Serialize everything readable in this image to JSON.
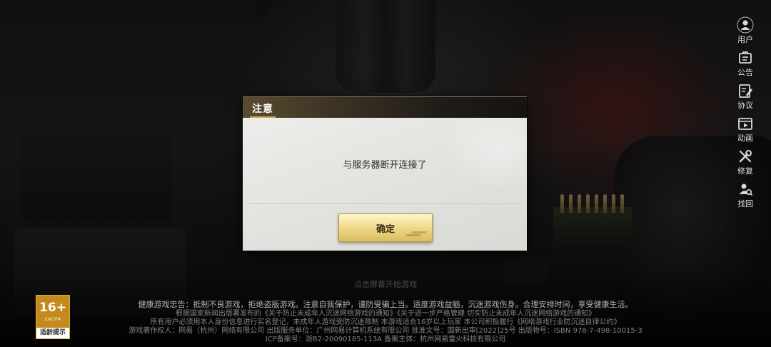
{
  "side_menu": {
    "items": [
      {
        "label": "用户",
        "icon": "user-icon"
      },
      {
        "label": "公告",
        "icon": "notice-icon"
      },
      {
        "label": "协议",
        "icon": "agreement-icon"
      },
      {
        "label": "动画",
        "icon": "animation-icon"
      },
      {
        "label": "修复",
        "icon": "repair-icon"
      },
      {
        "label": "找回",
        "icon": "recover-icon"
      }
    ]
  },
  "dialog": {
    "title": "注意",
    "message": "与服务器断开连接了",
    "confirm_label": "确定"
  },
  "start_hint": "点击屏幕开始游戏",
  "footer": {
    "health_notice": "健康游戏忠告：抵制不良游戏，拒绝盗版游戏。注意自我保护，谨防受骗上当。适度游戏益脑，沉迷游戏伤身。合理安排时间，享受健康生活。",
    "line2": "根据国家新闻出版署发布的《关于防止未成年人沉迷网络游戏的通知》《关于进一步严格管理 切实防止未成年人沉迷网络游戏的通知》",
    "line3": "所有用户必须用本人身份信息进行实名登记，未成年人游戏受防沉迷限制  本游戏适合16岁以上玩家  本公司积极履行《网络游戏行业防沉迷自律公约》",
    "line4": "游戏著作权人：网易（杭州）网络有限公司 出版服务单位：广州网易计算机系统有限公司 批准文号：国新出审[2022]25号 出版物号：ISBN 978-7-498-10015-3",
    "line5": "ICP备案号：浙B2-20090185-113A 备案主体：杭州网易雷火科技有限公司"
  },
  "age_rating": {
    "number": "16+",
    "org": "CADPA",
    "label": "适龄提示",
    "color": "#c58a1c"
  },
  "colors": {
    "accent_gold": "#d9bd5f",
    "dialog_header": "#3a3124"
  }
}
